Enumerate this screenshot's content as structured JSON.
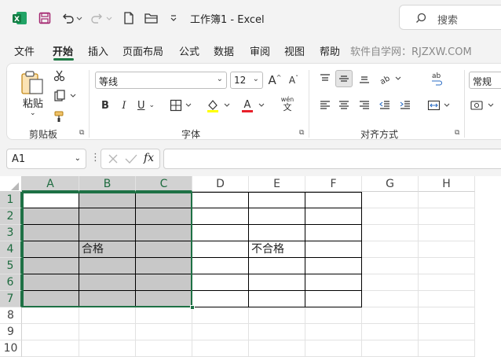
{
  "titlebar": {
    "title": "工作簿1  -  Excel",
    "search_label": "搜索",
    "icons": [
      "excel-logo",
      "save-icon",
      "undo-icon",
      "redo-icon",
      "new-file-icon",
      "open-folder-icon",
      "customize-qat-icon",
      "search-icon"
    ]
  },
  "menu": {
    "tabs": [
      "文件",
      "开始",
      "插入",
      "页面布局",
      "公式",
      "数据",
      "审阅",
      "视图",
      "帮助"
    ],
    "active": "开始",
    "watermark": "软件自学网：RJZXW.COM"
  },
  "ribbon": {
    "clipboard": {
      "paste_label": "粘贴",
      "group_label": "剪贴板"
    },
    "font": {
      "font_name": "等线",
      "font_size": "12",
      "group_label": "字体",
      "wen_label": "wén",
      "wen_char": "文"
    },
    "alignment": {
      "group_label": "对齐方式"
    },
    "number": {
      "format": "常规"
    }
  },
  "formula_bar": {
    "name_box": "A1",
    "fx_label": "fx",
    "formula": ""
  },
  "sheet": {
    "columns": [
      "A",
      "B",
      "C",
      "D",
      "E",
      "F",
      "G",
      "H"
    ],
    "rows": [
      "1",
      "2",
      "3",
      "4",
      "5",
      "6",
      "7",
      "8",
      "9",
      "10"
    ],
    "cells": {
      "B4": "合格",
      "E4": "不合格"
    },
    "accent_color": "#1e7145",
    "fill_color": "#c8c8c8"
  }
}
